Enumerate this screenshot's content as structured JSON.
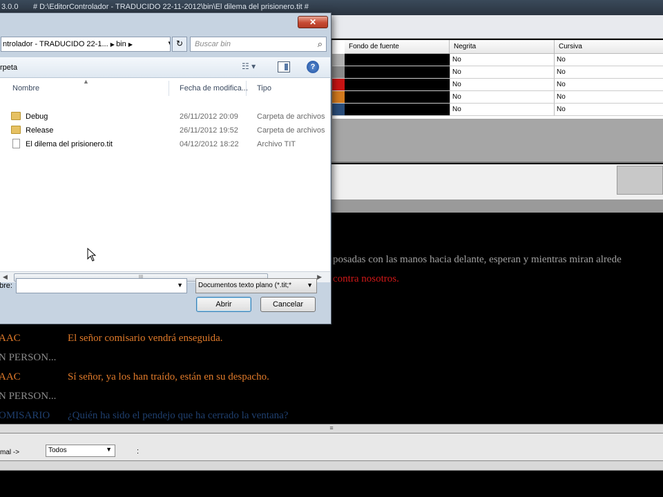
{
  "app": {
    "version": "3.0.0",
    "title": "# D:\\EditorControlador - TRADUCIDO 22-11-2012\\bin\\El dilema del prisionero.tit #"
  },
  "grid": {
    "headers": [
      "Fondo de fuente",
      "Negrita",
      "Cursiva"
    ],
    "rows": [
      {
        "color": "#b0b0b0",
        "negrita": "No",
        "cursiva": "No"
      },
      {
        "color": "#8a8a8a",
        "negrita": "No",
        "cursiva": "No"
      },
      {
        "color": "#c81414",
        "negrita": "No",
        "cursiva": "No"
      },
      {
        "color": "#d27a1e",
        "negrita": "No",
        "cursiva": "No"
      },
      {
        "color": "#2a4d7a",
        "negrita": "No",
        "cursiva": "No"
      }
    ]
  },
  "script": {
    "lines": [
      {
        "name": "",
        "text": "posadas con las manos hacia delante, esperan y mientras miran alrede",
        "color": "#a0a0a0"
      },
      {
        "name": "",
        "text": "contra nosotros.",
        "color": "#d01818"
      },
      {
        "name": "AAC",
        "text": "El señor comisario vendrá enseguida.",
        "color": "#e07a2a"
      },
      {
        "name": "N PERSON...",
        "text": "",
        "color": "#8c8c8c"
      },
      {
        "name": "AAC",
        "text": "Sí señor, ya los han traído, están en su despacho.",
        "color": "#e07a2a"
      },
      {
        "name": "N PERSON...",
        "text": "",
        "color": "#8c8c8c"
      },
      {
        "name": "OMISARIO",
        "text": "¿Quién ha sido el pendejo que ha cerrado la ventana?",
        "color": "#1f3f6e"
      }
    ]
  },
  "bottom": {
    "label": "mal ->",
    "filter_value": "Todos",
    "colon": ":"
  },
  "dialog": {
    "close_glyph": "✕",
    "address": {
      "segment1": "ntrolador - TRADUCIDO 22-1...",
      "segment2": "bin"
    },
    "search_placeholder": "Buscar bin",
    "toolbar": {
      "new_folder": "rpeta"
    },
    "columns": {
      "name": "Nombre",
      "date": "Fecha de modifica...",
      "type": "Tipo"
    },
    "files": [
      {
        "name": "Debug",
        "date": "26/11/2012 20:09",
        "type": "Carpeta de archivos",
        "icon": "folder-icon"
      },
      {
        "name": "Release",
        "date": "26/11/2012 19:52",
        "type": "Carpeta de archivos",
        "icon": "folder-icon"
      },
      {
        "name": "El dilema del prisionero.tit",
        "date": "04/12/2012 18:22",
        "type": "Archivo TIT",
        "icon": "file-icon"
      }
    ],
    "filename_label": "bre:",
    "filename_value": "",
    "filetype_value": "Documentos texto plano (*.tit;*",
    "open_label": "Abrir",
    "cancel_label": "Cancelar"
  }
}
